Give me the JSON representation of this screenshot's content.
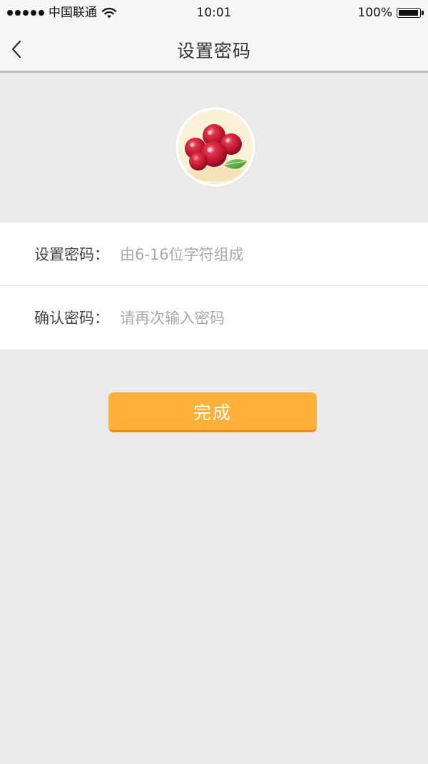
{
  "status_bar": {
    "carrier": "中国联通",
    "time": "10:01",
    "battery": "100%",
    "battery_level": 1.0,
    "signal_icon": "signal-dots-icon",
    "wifi_icon": "wifi-icon",
    "battery_icon": "battery-icon"
  },
  "nav": {
    "title": "设置密码",
    "back_icon": "chevron-left-icon"
  },
  "avatar": {
    "image": "cherry-fruit-avatar"
  },
  "form": {
    "password_label": "设置密码：",
    "password_placeholder": "由6-16位字符组成",
    "password_value": "",
    "confirm_label": "确认密码：",
    "confirm_placeholder": "请再次输入密码",
    "confirm_value": ""
  },
  "submit": {
    "label": "完成"
  },
  "colors": {
    "accent": "#ffb13b",
    "accent_border": "#f08a1e",
    "background": "#ebebeb",
    "placeholder": "#a9a9a9"
  }
}
